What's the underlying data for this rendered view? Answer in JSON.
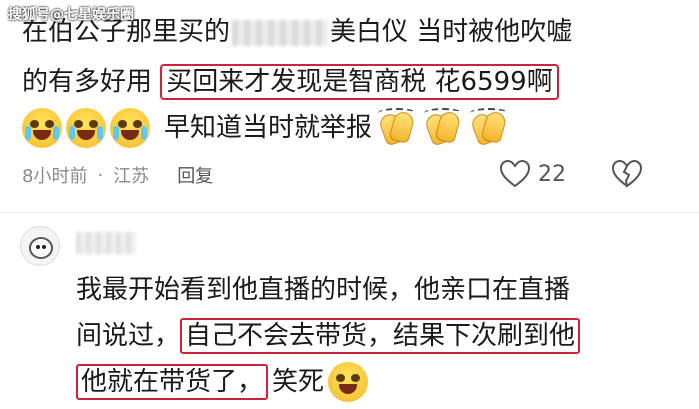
{
  "watermark": "搜狐号@七星娱乐圈",
  "comment1": {
    "line1_a": "在伯公子那里买的",
    "line1_b": "美白仪 当时被他吹嘘",
    "line2_a": "的有多好用",
    "line2_highlight": "买回来才发现是智商税 花6599啊",
    "line3_text": "早知道当时就举报",
    "time": "8小时前",
    "separator": "·",
    "location": "江苏",
    "reply_label": "回复",
    "like_count": "22"
  },
  "comment2": {
    "line1": "我最开始看到他直播的时候，他亲口在直播",
    "line2_a": "间说过，",
    "line2_highlight": "自己不会去带货，结果下次刷到他",
    "line3_highlight": "他就在带货了，",
    "line3_b": "笑死"
  },
  "colors": {
    "highlight_border": "#d0213a",
    "meta_text": "#8a8a8a"
  }
}
